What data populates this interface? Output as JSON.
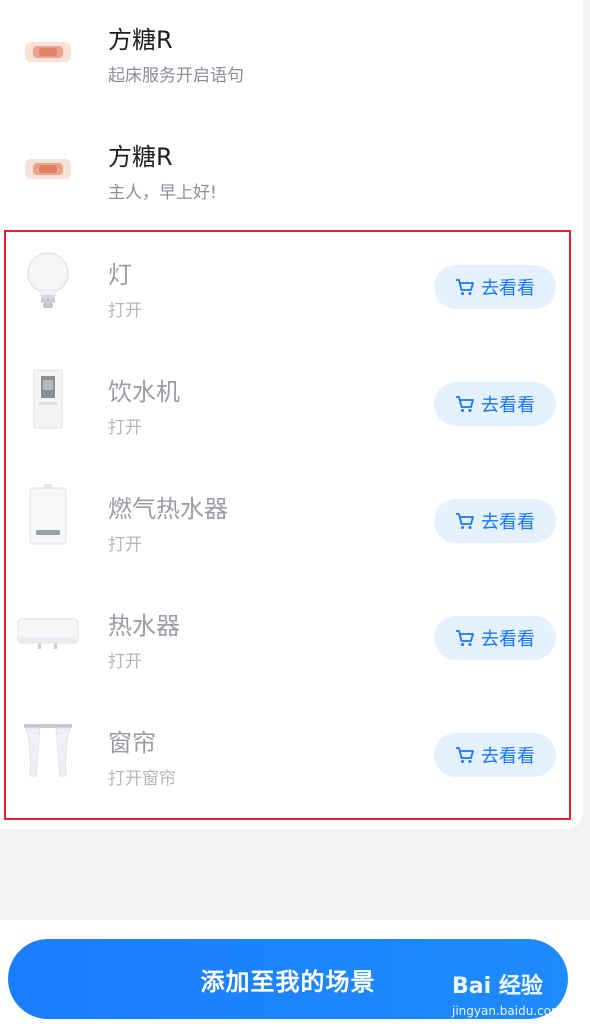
{
  "voice_items": [
    {
      "title": "方糖R",
      "subtitle": "起床服务开启语句"
    },
    {
      "title": "方糖R",
      "subtitle": "主人，早上好!"
    }
  ],
  "devices": [
    {
      "title": "灯",
      "subtitle": "打开",
      "icon": "bulb-icon",
      "button": "去看看"
    },
    {
      "title": "饮水机",
      "subtitle": "打开",
      "icon": "water-dispenser-icon",
      "button": "去看看"
    },
    {
      "title": "燃气热水器",
      "subtitle": "打开",
      "icon": "gas-water-heater-icon",
      "button": "去看看"
    },
    {
      "title": "热水器",
      "subtitle": "打开",
      "icon": "water-heater-icon",
      "button": "去看看"
    },
    {
      "title": "窗帘",
      "subtitle": "打开窗帘",
      "icon": "curtain-icon",
      "button": "去看看"
    }
  ],
  "footer": {
    "add_label": "添加至我的场景"
  },
  "watermark": {
    "logo_text": "Bai 经验",
    "url": "jingyan.baidu.com"
  },
  "colors": {
    "accent": "#1677ff",
    "button_bg": "#e5f1ff",
    "highlight_border": "#e0242f"
  }
}
